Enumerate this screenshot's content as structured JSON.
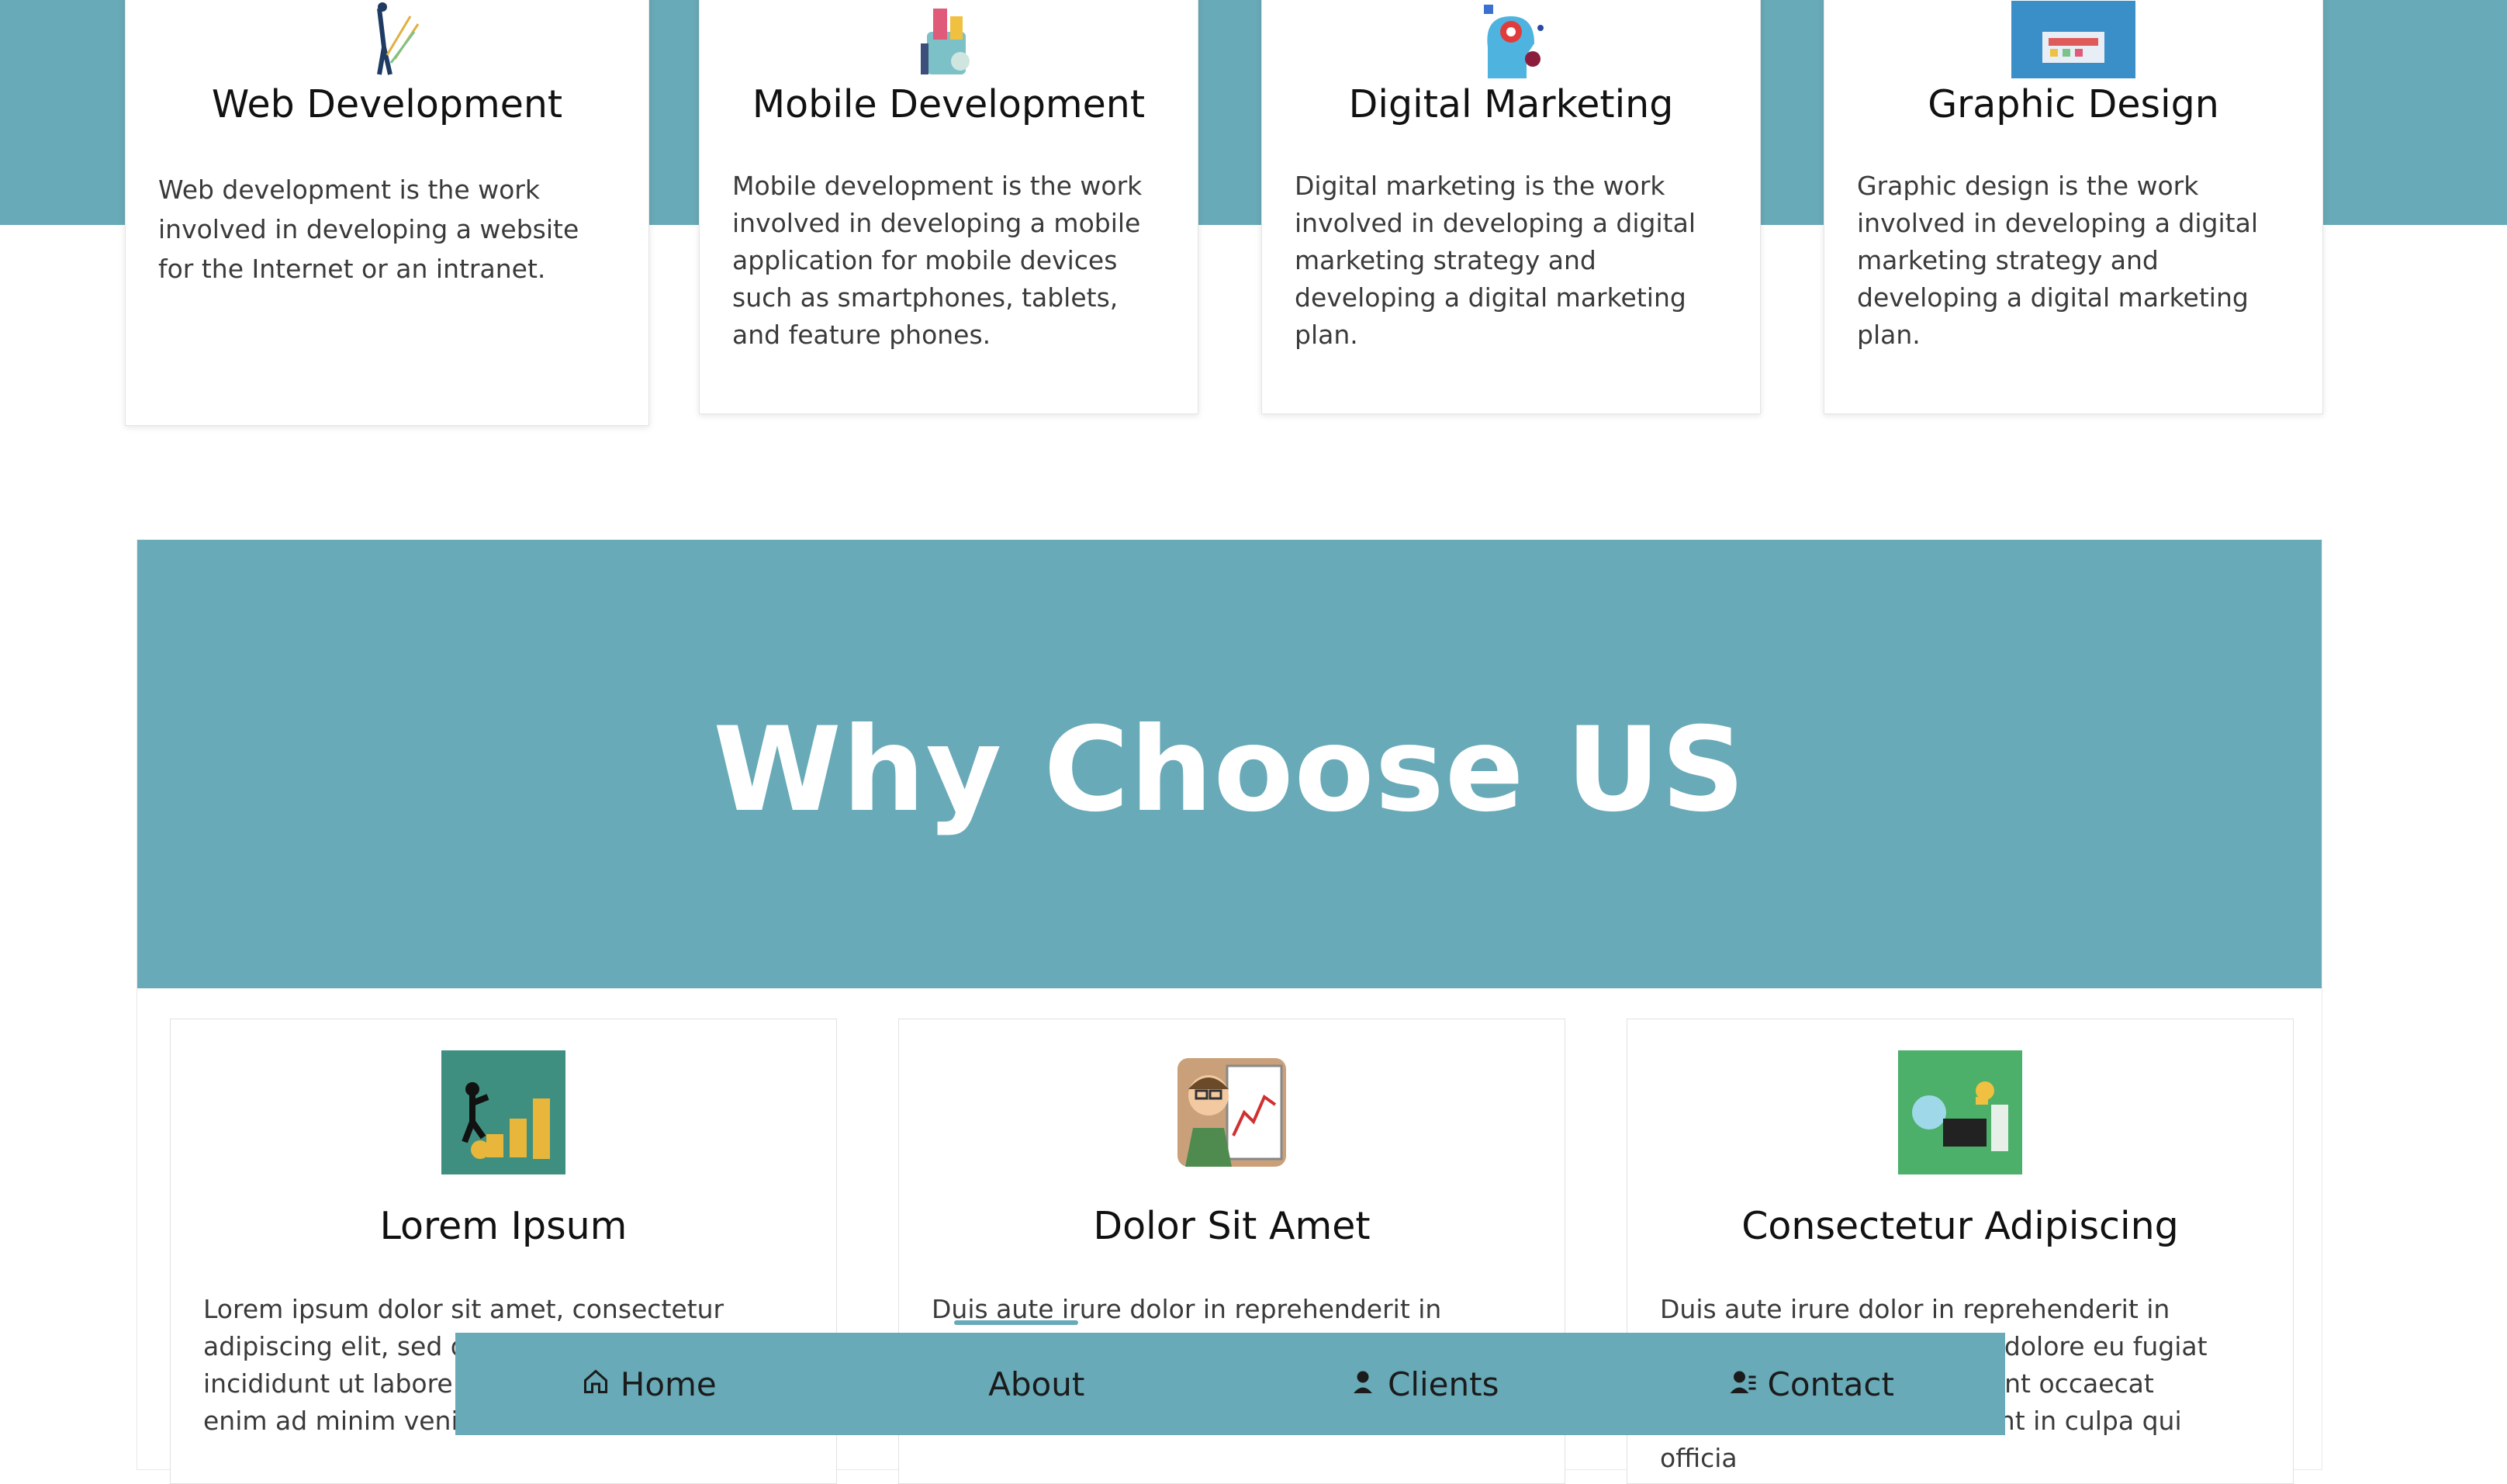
{
  "services": [
    {
      "title": "Web Development",
      "desc": "Web development is the work involved in developing a website for the Internet or an intranet.",
      "icon": "growth-chart-person-icon"
    },
    {
      "title": "Mobile Development",
      "desc": "Mobile development is the work involved in developing a mobile application for mobile devices such as smartphones, tablets, and feature phones.",
      "icon": "mobile-app-icon"
    },
    {
      "title": "Digital Marketing",
      "desc": "Digital marketing is the work involved in developing a digital marketing strategy and developing a digital marketing plan.",
      "icon": "marketing-head-icon"
    },
    {
      "title": "Graphic Design",
      "desc": "Graphic design is the work involved in developing a digital marketing strategy and developing a digital marketing plan.",
      "icon": "design-screen-icon"
    }
  ],
  "why": {
    "heading": "Why Choose US",
    "cards": [
      {
        "title": "Lorem Ipsum",
        "text": "Lorem ipsum dolor sit amet, consectetur adipiscing elit, sed do eiusmod tempor incididunt ut labore et dolore magna aliqua. Ut enim ad minim veniam",
        "icon": "coins-businessman-icon"
      },
      {
        "title": "Dolor Sit Amet",
        "text": "Duis aute irure dolor in reprehenderit in voluptate velit esse cillum dolore eu fugiat nulla pariatur.",
        "icon": "chart-clipboard-man-icon"
      },
      {
        "title": "Consectetur Adipiscing",
        "text": "Duis aute irure dolor in reprehenderit in voluptate velit esse cillum dolore eu fugiat nulla pariatur. Excepteur sint occaecat cupidatat non proident, sunt in culpa qui officia",
        "icon": "online-business-icon"
      }
    ]
  },
  "nav": {
    "home": "Home",
    "about": "About",
    "clients": "Clients",
    "contact": "Contact"
  },
  "colors": {
    "accent": "#69aab8",
    "text": "#1a1a1a"
  }
}
